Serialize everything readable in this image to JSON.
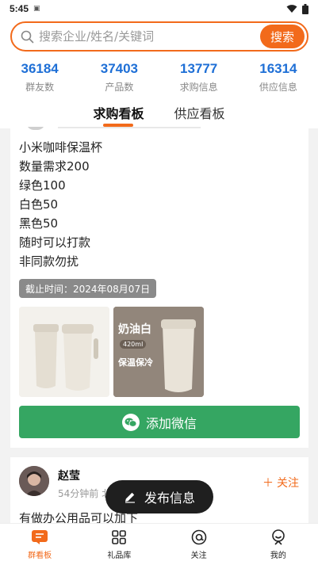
{
  "status_bar": {
    "time": "5:45",
    "mini_icon": "sim-icon"
  },
  "search": {
    "placeholder": "搜索企业/姓名/关键词",
    "button": "搜索"
  },
  "stats": [
    {
      "value": "36184",
      "label": "群友数"
    },
    {
      "value": "37403",
      "label": "产品数"
    },
    {
      "value": "13777",
      "label": "求购信息"
    },
    {
      "value": "16314",
      "label": "供应信息"
    }
  ],
  "tabs": [
    {
      "label": "求购看板",
      "active": true
    },
    {
      "label": "供应看板",
      "active": false
    }
  ],
  "post1": {
    "lines": [
      "小米咖啡保温杯",
      "数量需求200",
      "绿色100",
      "白色50",
      "黑色50",
      "随时可以打款",
      "非同款勿扰"
    ],
    "deadline": "截止时间：2024年08月07日",
    "image2_title": "奶油白",
    "image2_badge": "420ml",
    "image2_tag": "保温保冷",
    "wechat_button": "添加微信"
  },
  "post2": {
    "user_name": "赵莹",
    "meta": "54分钟前 北",
    "follow_button": "关注",
    "text": "有做办公用品可以加下"
  },
  "fab": {
    "label": "发布信息"
  },
  "bottom_nav": [
    {
      "label": "群看板",
      "icon": "board-icon",
      "active": true
    },
    {
      "label": "礼品库",
      "icon": "grid-icon",
      "active": false
    },
    {
      "label": "关注",
      "icon": "at-icon",
      "active": false
    },
    {
      "label": "我的",
      "icon": "profile-icon",
      "active": false
    }
  ],
  "colors": {
    "accent": "#f26a1b",
    "stat_blue": "#1e6fd6",
    "wechat_green": "#35a662"
  }
}
